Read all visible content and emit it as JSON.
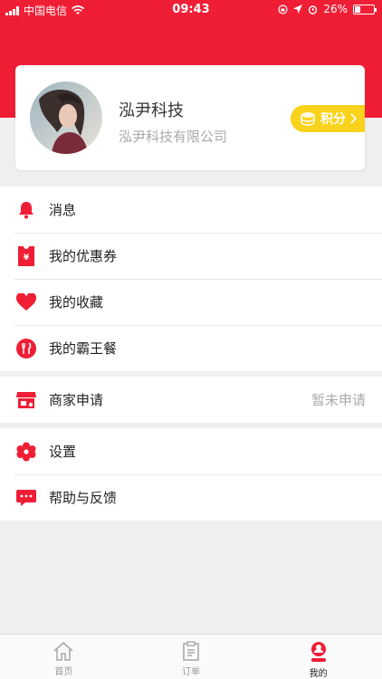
{
  "status_bar": {
    "carrier": "中国电信",
    "time": "09:43",
    "battery": "26%",
    "battery_level": 0.26
  },
  "profile": {
    "name": "泓尹科技",
    "company": "泓尹科技有限公司",
    "points_label": "积分"
  },
  "menu": {
    "group1": [
      {
        "label": "消息",
        "icon": "bell-icon"
      },
      {
        "label": "我的优惠券",
        "icon": "coupon-icon"
      },
      {
        "label": "我的收藏",
        "icon": "heart-icon"
      },
      {
        "label": "我的霸王餐",
        "icon": "utensils-icon"
      }
    ],
    "group2": [
      {
        "label": "商家申请",
        "value": "暂未申请",
        "icon": "store-icon"
      }
    ],
    "group3": [
      {
        "label": "设置",
        "icon": "gear-icon"
      },
      {
        "label": "帮助与反馈",
        "icon": "chat-icon"
      }
    ]
  },
  "tabs": [
    {
      "label": "首页",
      "icon": "home-icon"
    },
    {
      "label": "订单",
      "icon": "clipboard-icon"
    },
    {
      "label": "我的",
      "icon": "user-icon",
      "active": true
    }
  ],
  "colors": {
    "brand": "#ef1e35",
    "points": "#f9d21c"
  }
}
